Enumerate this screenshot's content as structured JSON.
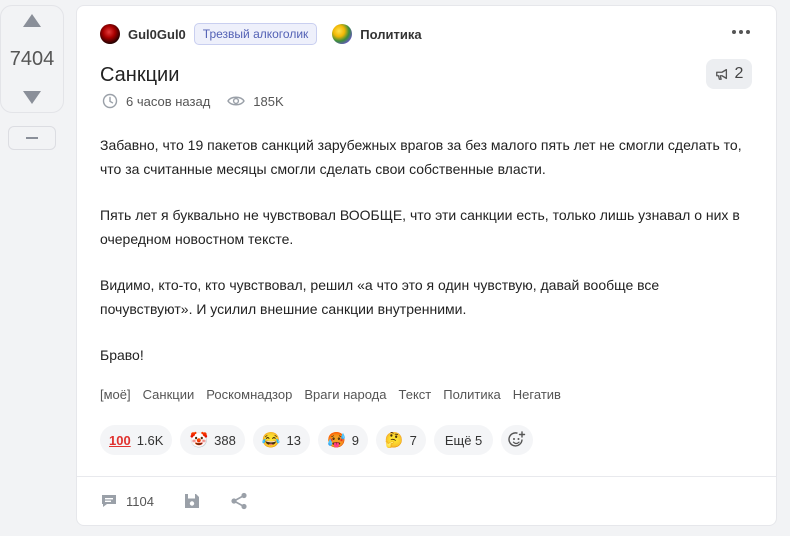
{
  "vote": {
    "rating": "7404"
  },
  "post": {
    "author": "Gul0Gul0",
    "badge": "Трезвый алкоголик",
    "community": "Политика",
    "title": "Санкции",
    "time": "6 часов назад",
    "views": "185K",
    "share_count": "2",
    "paragraphs": [
      "Забавно, что 19 пакетов санкций зарубежных врагов за без малого пять лет не смогли сделать то, что за считанные месяцы смогли сделать свои собственные власти.",
      "Пять лет я буквально не чувствовал ВООБЩЕ, что эти санкции есть, только лишь узнавал о них в очередном новостном тексте.",
      "Видимо, кто-то, кто чувствовал, решил «а что это я один чувствую, давай вообще все почувствуют». И усилил внешние санкции внутренними.",
      "Браво!"
    ],
    "tags": [
      "[моё]",
      "Санкции",
      "Роскомнадзор",
      "Враги народа",
      "Текст",
      "Политика",
      "Негатив"
    ]
  },
  "reactions": [
    {
      "emoji": "100",
      "count": "1.6K",
      "icon": "hundred-points"
    },
    {
      "emoji": "🤡",
      "count": "388",
      "icon": "clown-face"
    },
    {
      "emoji": "😂",
      "count": "13",
      "icon": "tears-of-joy"
    },
    {
      "emoji": "🥵",
      "count": "9",
      "icon": "hot-face"
    },
    {
      "emoji": "🤔",
      "count": "7",
      "icon": "thinking-face"
    }
  ],
  "reactions_more": "Ещё 5",
  "footer": {
    "comments": "1104"
  }
}
